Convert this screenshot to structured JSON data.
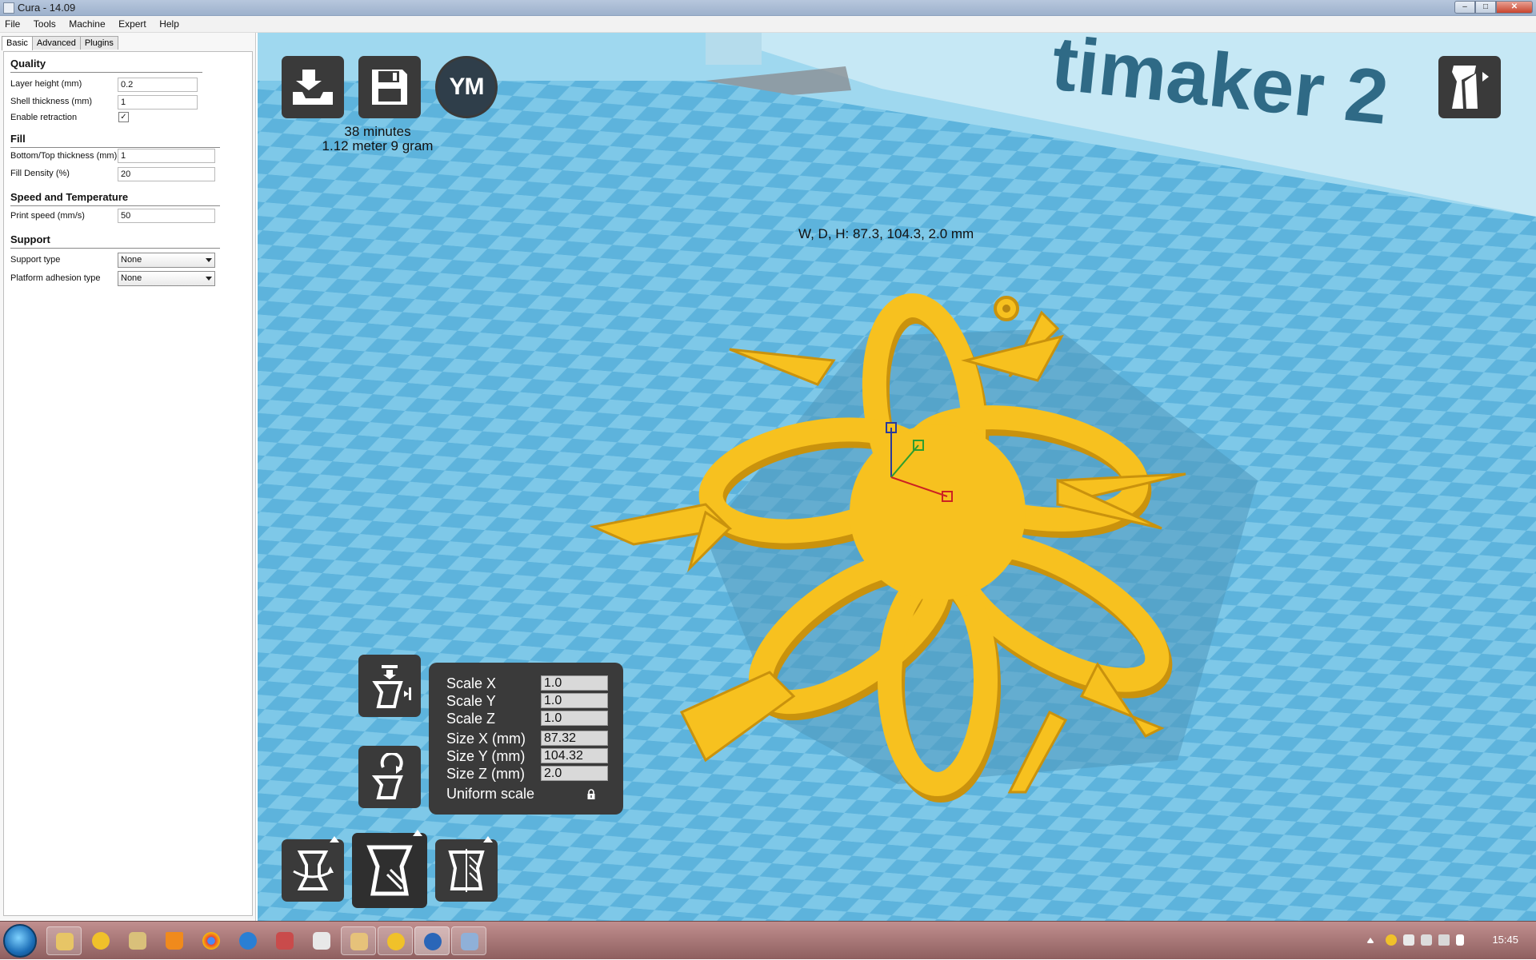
{
  "window": {
    "title": "Cura - 14.09"
  },
  "menu": [
    "File",
    "Tools",
    "Machine",
    "Expert",
    "Help"
  ],
  "tabs": [
    "Basic",
    "Advanced",
    "Plugins"
  ],
  "sections": {
    "quality": {
      "title": "Quality",
      "layer_height": {
        "label": "Layer height (mm)",
        "value": "0.2"
      },
      "shell_thickness": {
        "label": "Shell thickness (mm)",
        "value": "1"
      },
      "enable_retraction": {
        "label": "Enable retraction",
        "checked": true
      }
    },
    "fill": {
      "title": "Fill",
      "bottom_top": {
        "label": "Bottom/Top thickness (mm)",
        "value": "1"
      },
      "density": {
        "label": "Fill Density (%)",
        "value": "20"
      }
    },
    "speed": {
      "title": "Speed and Temperature",
      "print_speed": {
        "label": "Print speed (mm/s)",
        "value": "50"
      }
    },
    "support": {
      "title": "Support",
      "support_type": {
        "label": "Support type",
        "value": "None"
      },
      "adhesion": {
        "label": "Platform adhesion type",
        "value": "None"
      }
    }
  },
  "viewport": {
    "print_time": "38 minutes",
    "print_material": "1.12 meter 9 gram",
    "dimensions": "W, D, H: 87.3, 104.3, 2.0 mm",
    "ym_label": "YM",
    "watermark": "timaker 2"
  },
  "scale_panel": {
    "rows": [
      {
        "label": "Scale X",
        "value": "1.0"
      },
      {
        "label": "Scale Y",
        "value": "1.0"
      },
      {
        "label": "Scale Z",
        "value": "1.0"
      },
      {
        "label": "Size X (mm)",
        "value": "87.32"
      },
      {
        "label": "Size Y (mm)",
        "value": "104.32"
      },
      {
        "label": "Size Z (mm)",
        "value": "2.0"
      }
    ],
    "uniform_label": "Uniform scale"
  },
  "taskbar": {
    "clock": "15:45"
  },
  "colors": {
    "model": "#f7c11f",
    "viewport": "#87cdea",
    "tile": "#5fb6dc",
    "button": "#3a3a3a"
  }
}
